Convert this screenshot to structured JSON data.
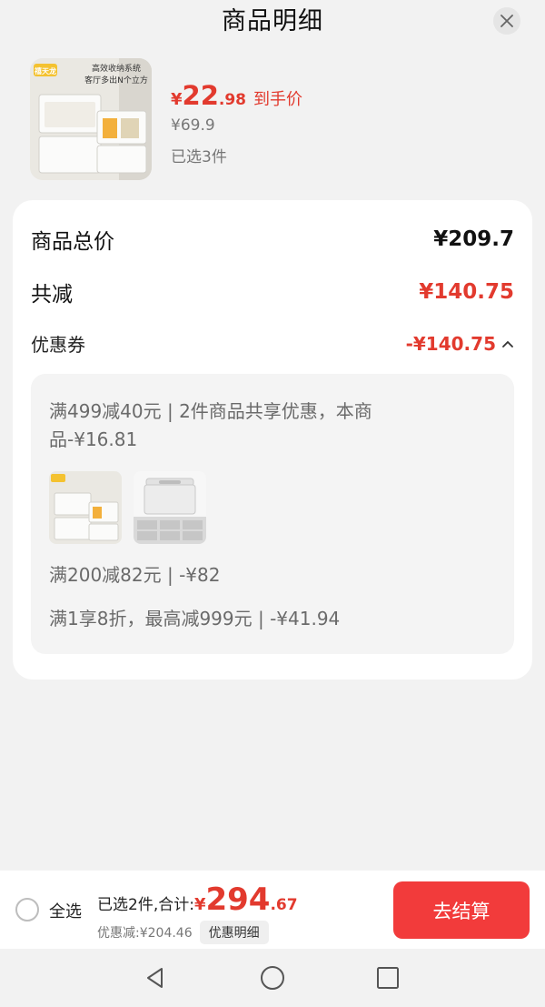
{
  "header": {
    "title": "商品明细"
  },
  "product": {
    "thumb_banner_line1": "高效收纳系统",
    "thumb_banner_line2": "客厅多出N个立方",
    "thumb_brand": "禧天龙",
    "price_currency": "¥",
    "price_int": "22",
    "price_dec": ".98",
    "price_tag": "到手价",
    "original_price": "¥69.9",
    "selected": "已选3件"
  },
  "summary_card": {
    "total_label": "商品总价",
    "total_value": "¥209.7",
    "reduce_label": "共减",
    "reduce_value": "¥140.75",
    "coupon_label": "优惠券",
    "coupon_value": "-¥140.75",
    "coupon_details": [
      "满499减40元 | 2件商品共享优惠，本商",
      "品-¥16.81",
      "满200减82元 | -¥82",
      "满1享8折，最高减999元 | -¥41.94"
    ]
  },
  "bottom_bar": {
    "select_all": "全选",
    "selected_total_label": "已选2件,合计:",
    "total_currency": "¥",
    "total_int": "294",
    "total_dec": ".67",
    "discount_text": "优惠减:¥204.46",
    "detail_button": "优惠明细",
    "checkout_button": "去结算"
  },
  "colors": {
    "accent_red": "#e23a2e",
    "checkout_bg": "#f23b3b"
  },
  "icons": [
    "close-icon",
    "chevron-up-icon",
    "back-triangle-icon",
    "home-circle-icon",
    "recents-square-icon"
  ]
}
